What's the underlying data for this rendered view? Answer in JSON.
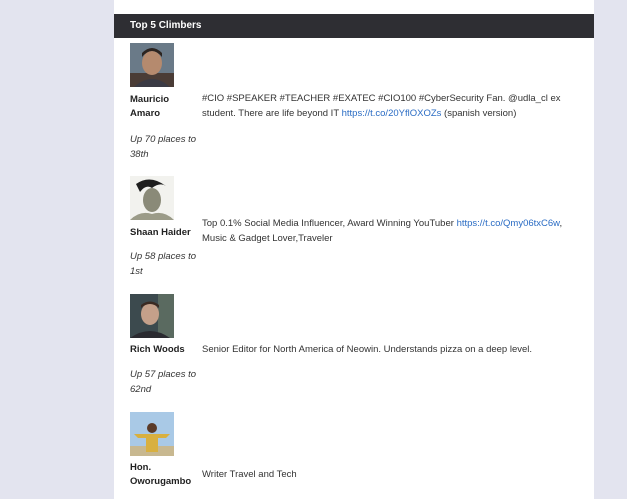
{
  "section": {
    "title": "Top 5 Climbers"
  },
  "climbers": [
    {
      "name": "Mauricio Amaro",
      "change": "Up 70 places to 38th",
      "bio_text": "#CIO #SPEAKER #TEACHER #EXATEC #CIO100 #CyberSecurity Fan. @udla_cl ex student. There are life beyond IT ",
      "bio_link": "https://t.co/20YflOXOZs",
      "bio_suffix": " (spanish version)"
    },
    {
      "name": "Shaan Haider",
      "change": "Up 58 places to 1st",
      "bio_text": "Top 0.1% Social Media Influencer, Award Winning YouTuber ",
      "bio_link": "https://t.co/Qmy06txC6w",
      "bio_suffix": ", Music & Gadget Lover,Traveler"
    },
    {
      "name": "Rich Woods",
      "change": "Up 57 places to 62nd",
      "bio_text": "Senior Editor for North America of Neowin. Understands pizza on a deep level.",
      "bio_link": "",
      "bio_suffix": ""
    },
    {
      "name": "Hon. Oworugambo",
      "change": "",
      "bio_text": "Writer Travel and Tech",
      "bio_link": "",
      "bio_suffix": ""
    }
  ],
  "colors": {
    "header_bg": "#2e2e33",
    "link": "#2a6cc4",
    "page_bg": "#e3e4ef"
  }
}
